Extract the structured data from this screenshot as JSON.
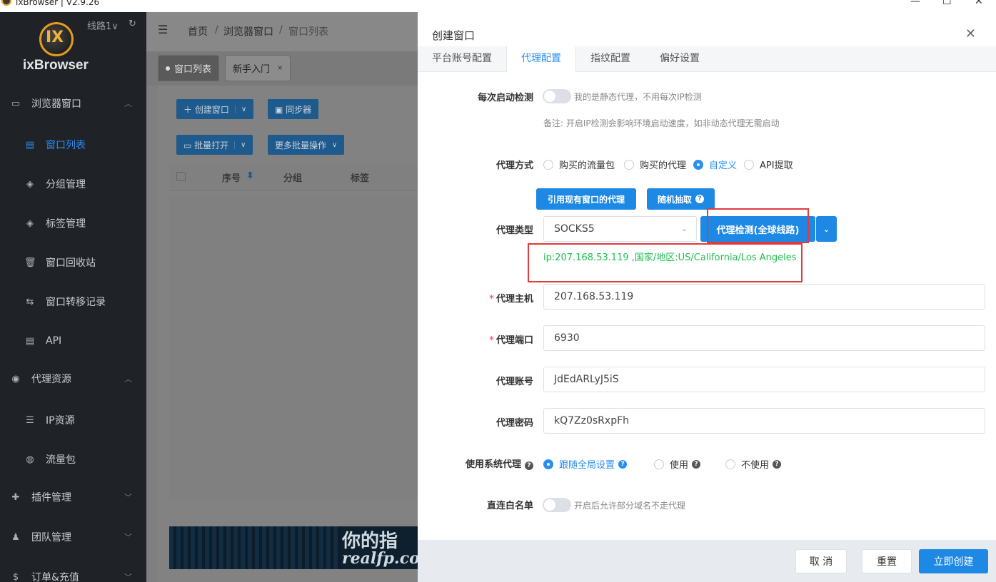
{
  "window": {
    "title": "ixBrowser | V2.9.26",
    "minimize": "—",
    "maximize": "☐",
    "close": "✕"
  },
  "sidebar": {
    "brand": "ixBrowser",
    "logo_text": "IX",
    "line_select": "线路1∨",
    "refresh_icon": "↻",
    "items": [
      {
        "label": "浏览器窗口",
        "icon": "▭",
        "chevron": "︿"
      },
      {
        "label": "窗口列表",
        "icon": "▤"
      },
      {
        "label": "分组管理",
        "icon": "◈"
      },
      {
        "label": "标签管理",
        "icon": "◈"
      },
      {
        "label": "窗口回收站",
        "icon": "🗑"
      },
      {
        "label": "窗口转移记录",
        "icon": "⇆"
      },
      {
        "label": "API",
        "icon": "▤"
      },
      {
        "label": "代理资源",
        "icon": "◉",
        "chevron": "︿"
      },
      {
        "label": "IP资源",
        "icon": "☰"
      },
      {
        "label": "流量包",
        "icon": "◍"
      },
      {
        "label": "插件管理",
        "icon": "✚",
        "chevron": "﹀"
      },
      {
        "label": "团队管理",
        "icon": "♟",
        "chevron": "﹀"
      },
      {
        "label": "订单&充值",
        "icon": "$",
        "chevron": "﹀"
      }
    ]
  },
  "main": {
    "menu_icon": "☰",
    "breadcrumb": [
      "首页",
      "/",
      "浏览器窗口",
      "/",
      "窗口列表"
    ],
    "tabs": [
      {
        "label": "窗口列表"
      },
      {
        "label": "新手入门",
        "close": "×"
      }
    ],
    "create_btn": "＋ 创建窗口",
    "sync_btn": "▣ 同步器",
    "batch_open_btn": "▭ 批量打开",
    "more_batch_btn": "更多批量操作",
    "dropdown": "∨",
    "columns": [
      "序号",
      "分组",
      "标签"
    ],
    "sort_icon": "⬍",
    "banner_text1": "你的指",
    "banner_text2": "realfp.co"
  },
  "drawer": {
    "title": "创建窗口",
    "close": "✕",
    "tabs": [
      "平台账号配置",
      "代理配置",
      "指纹配置",
      "偏好设置"
    ],
    "startup_check_label": "每次启动检测",
    "startup_check_hint": "我的是静态代理，不用每次IP检测",
    "startup_check_note": "备注: 开启IP检测会影响环境启动速度，如非动态代理无需启动",
    "proxy_method_label": "代理方式",
    "proxy_methods": [
      "购买的流量包",
      "购买的代理",
      "自定义",
      "API提取"
    ],
    "selected_method": "自定义",
    "cite_btn": "引用现有窗口的代理",
    "random_btn": "随机抽取",
    "proxy_type_label": "代理类型",
    "proxy_type_value": "SOCKS5",
    "check_btn": "代理检测(全球线路)",
    "check_result": "ip:207.168.53.119 ,国家/地区:US/California/Los Angeles",
    "host_label": "代理主机",
    "host_value": "207.168.53.119",
    "port_label": "代理端口",
    "port_value": "6930",
    "account_label": "代理账号",
    "account_value": "JdEdARLyJ5iS",
    "password_label": "代理密码",
    "password_value": "kQ7Zz0sRxpFh",
    "sys_proxy_label": "使用系统代理",
    "sys_proxy_options": [
      "跟随全局设置",
      "使用",
      "不使用"
    ],
    "whitelist_label": "直连白名单",
    "whitelist_hint": "开启后允许部分域名不走代理",
    "required_mark": "*",
    "qmark": "?",
    "cancel_btn": "取 消",
    "reset_btn": "重置",
    "create_btn": "立即创建"
  }
}
